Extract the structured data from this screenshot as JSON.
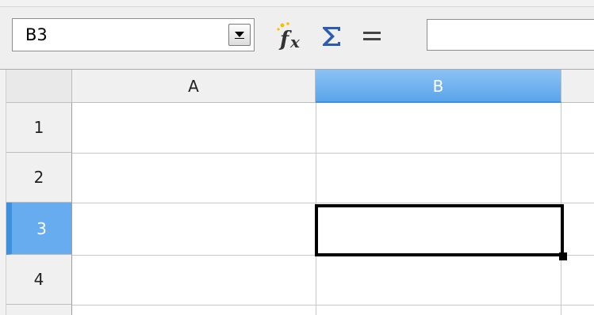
{
  "formula_bar": {
    "name_box_value": "B3",
    "function_wizard_icon": "fx-icon",
    "sum_icon": "sigma-icon",
    "function_icon": "equals-icon",
    "input_value": ""
  },
  "columns": [
    {
      "label": "A",
      "selected": false
    },
    {
      "label": "B",
      "selected": true
    }
  ],
  "rows": [
    {
      "label": "1",
      "selected": false
    },
    {
      "label": "2",
      "selected": false
    },
    {
      "label": "3",
      "selected": true
    },
    {
      "label": "4",
      "selected": false
    }
  ],
  "active_cell": "B3",
  "colors": {
    "selection_header": "#66acef",
    "cursor_border": "#000000"
  }
}
